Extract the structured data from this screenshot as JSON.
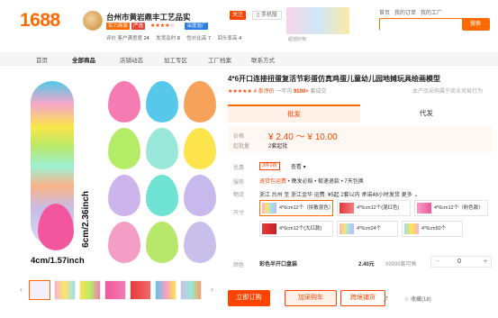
{
  "header": {
    "logo": "1688",
    "shop_name": "台州市黄岩鼎丰工艺品实",
    "follow_label": "关注",
    "phone_label": "手机版",
    "badges": [
      "实力商家",
      "严选",
      "深度验厂"
    ],
    "rating_stars": "★★★★☆",
    "metrics": [
      {
        "label": "评价",
        "value": ""
      },
      {
        "label": "客户满意度",
        "value": "24"
      },
      {
        "label": "发货及时",
        "value": "8"
      },
      {
        "label": "性价比高",
        "value": "7"
      },
      {
        "label": "回头率高",
        "value": "4"
      }
    ],
    "shop_thumb_label": "超值好物",
    "top_links": [
      "首页",
      "我的订单",
      "我的工厂"
    ],
    "search_placeholder": "",
    "search_button": "搜索"
  },
  "nav": {
    "items": [
      "首页",
      "全部商品",
      "店铺动态",
      "加工专区",
      "工厂档案",
      "联系方式"
    ],
    "active": "全部商品"
  },
  "gallery": {
    "dim_vertical": "6cm/2.36inch",
    "dim_horizontal": "4cm/1.57inch",
    "egg_colors": [
      "#f57cb3",
      "#56c8ea",
      "#f7a25a",
      "#b5ec67",
      "#9ae8d9",
      "#fde44d",
      "#cdb4ea",
      "#6fe3d3",
      "#c7b9ec",
      "#f49ec6",
      "#b8e86b",
      "#c8c0ea"
    ],
    "prev_arrow": "‹",
    "next_arrow": "›"
  },
  "product": {
    "title": "4*6开口连接扭蛋复活节彩蛋仿真鸡蛋儿童幼儿园地摊玩具绘画模型",
    "stars": "★★★★★",
    "review_count": "4 条评价",
    "sold_prefix": "一年内",
    "sold_value": "9100+",
    "sold_suffix": "套成交",
    "note": "本产品采购属于商业贸易行为"
  },
  "tabs": {
    "wholesale": "批发",
    "dropship": "代发"
  },
  "pricing": {
    "price_label": "价格",
    "price": "¥ 2.40 ～ ¥ 10.00",
    "moq_label": "起批量",
    "moq": "2套起批"
  },
  "promo": {
    "label": "优惠",
    "coupon": "3件9折",
    "view": "查看 ▾"
  },
  "services": {
    "label": "服务",
    "items": [
      "退货包运费",
      "晚发必赔",
      "极速退款",
      "7天包换"
    ]
  },
  "shipping": {
    "label": "物流",
    "text": "浙江 台州 至 浙江金华  运费: ¥5起   2套以内 承诺48小时发货  更多 ⌄"
  },
  "size": {
    "label": "尺寸",
    "options": [
      "4*6cm12个（拼散混色）",
      "4*6cm12个(混红色)",
      "4*6cm12个（粉色款）",
      "4*6cm12个(大红款)",
      "4*6cm24个",
      "4*6cm50个"
    ]
  },
  "color": {
    "label": "颜色",
    "name": "彩色半开口盘装",
    "price": "2.40元",
    "stock": "99999套可售",
    "qty": "0",
    "minus": "−",
    "plus": "+"
  },
  "actions": {
    "buy": "立即订购",
    "cart": "加采购车",
    "purchase": "跨境铺货",
    "share": "分享",
    "favorite": "收藏(18)"
  },
  "colors": {
    "accent": "#ff6a00",
    "price": "#ff4400"
  }
}
